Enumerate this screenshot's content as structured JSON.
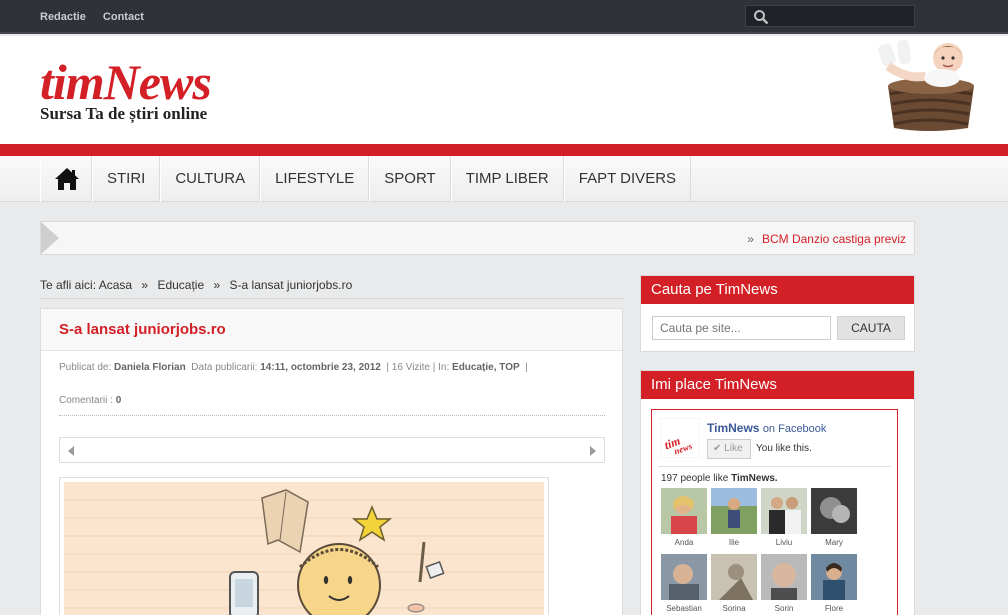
{
  "topbar": {
    "links": [
      "Redactie",
      "Contact"
    ],
    "search_placeholder": ""
  },
  "header": {
    "brand": "timNews",
    "tagline": "Sursa Ta de știri online"
  },
  "nav": {
    "items": [
      "STIRI",
      "CULTURA",
      "LIFESTYLE",
      "SPORT",
      "TIMP LIBER",
      "FAPT DIVERS"
    ]
  },
  "ticker": {
    "headline": "BCM Danzio castiga previz"
  },
  "breadcrumb": {
    "prefix": "Te afli aici:",
    "items": [
      "Acasa",
      "Educație",
      "S-a lansat juniorjobs.ro"
    ]
  },
  "article": {
    "title": "S-a lansat juniorjobs.ro",
    "published_label": "Publicat de:",
    "author": "Daniela Florian",
    "date_label": "Data publicarii:",
    "date": "14:11, octombrie 23, 2012",
    "visits": "| 16 Vizite | In:",
    "categories": "Educație, TOP",
    "trail": "|",
    "comments_label": "Comentarii :",
    "comments_count": "0"
  },
  "sidebar": {
    "search_title": "Cauta pe TimNews",
    "search_placeholder": "Cauta pe site...",
    "search_button": "CAUTA",
    "fb_title": "Imi place TimNews",
    "fb_page_name": "TimNews",
    "fb_on": "on Facebook",
    "fb_like_button": "Like",
    "fb_you_like": "You like this.",
    "fb_count_prefix": "197 people like",
    "fb_count_page": "TimNews.",
    "fans": [
      "Anda",
      "Ilie",
      "Liviu",
      "Mary",
      "Sebastian",
      "Sorina",
      "Sorin",
      "Flore"
    ]
  },
  "colors": {
    "accent": "#d31f26",
    "topbar": "#2f3338",
    "facebook": "#3b5998"
  }
}
